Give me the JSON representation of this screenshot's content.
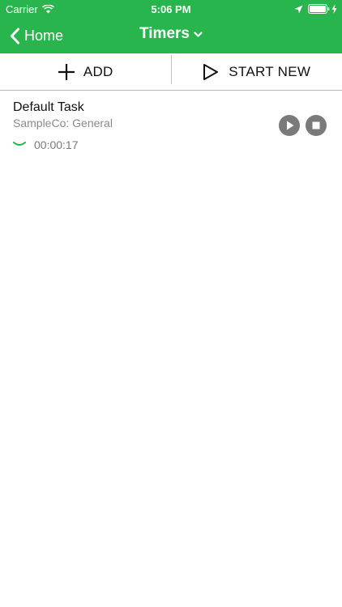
{
  "status_bar": {
    "carrier": "Carrier",
    "time": "5:06 PM",
    "icons": [
      "wifi-icon",
      "location-icon",
      "battery-icon",
      "charging-icon"
    ]
  },
  "nav": {
    "back_label": "Home",
    "title": "Timers",
    "back_icon": "chevron-left-icon",
    "title_icon": "chevron-down-icon"
  },
  "toolbar": {
    "add_label": "ADD",
    "start_new_label": "START NEW"
  },
  "timers": [
    {
      "task": "Default Task",
      "client": "SampleCo: General",
      "elapsed": "00:00:17"
    }
  ],
  "colors": {
    "brand_green": "#28b54d",
    "control_gray": "#7a7a7a"
  }
}
